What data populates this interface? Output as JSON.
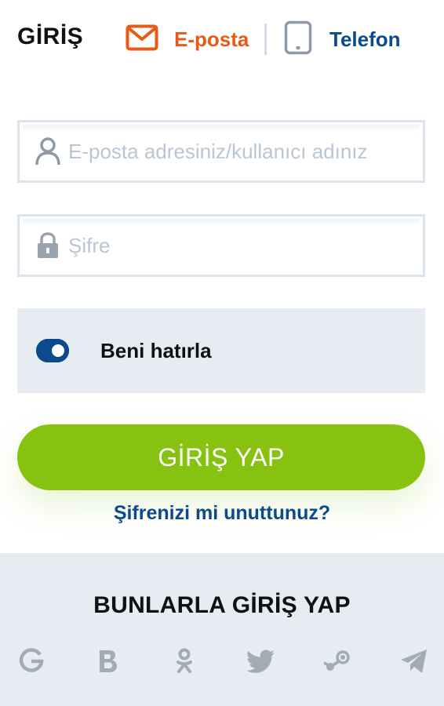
{
  "header": {
    "title": "GİRİŞ",
    "tabs": [
      {
        "label": "E-posta",
        "icon": "envelope-icon",
        "active": true,
        "color": "#e85a16"
      },
      {
        "label": "Telefon",
        "icon": "phone-icon",
        "active": false,
        "color": "#0b4a8c"
      }
    ]
  },
  "form": {
    "username": {
      "placeholder": "E-posta adresiniz/kullanıcı adınız",
      "value": "",
      "icon": "user-icon"
    },
    "password": {
      "placeholder": "Şifre",
      "value": "",
      "icon": "lock-icon"
    },
    "remember": {
      "label": "Beni hatırla",
      "checked": true
    },
    "submit_label": "GİRİŞ YAP",
    "forgot_label": "Şifrenizi mi unuttunuz?"
  },
  "social": {
    "title": "BUNLARLA GİRİŞ YAP",
    "providers": [
      "google-icon",
      "vk-icon",
      "odnoklassniki-icon",
      "twitter-icon",
      "steam-icon",
      "telegram-icon"
    ]
  },
  "colors": {
    "accent_orange": "#e85a16",
    "brand_blue": "#0b4a8c",
    "button_green": "#86c20f",
    "panel_gray": "#e7ecf2",
    "icon_gray": "#a2acb6"
  }
}
